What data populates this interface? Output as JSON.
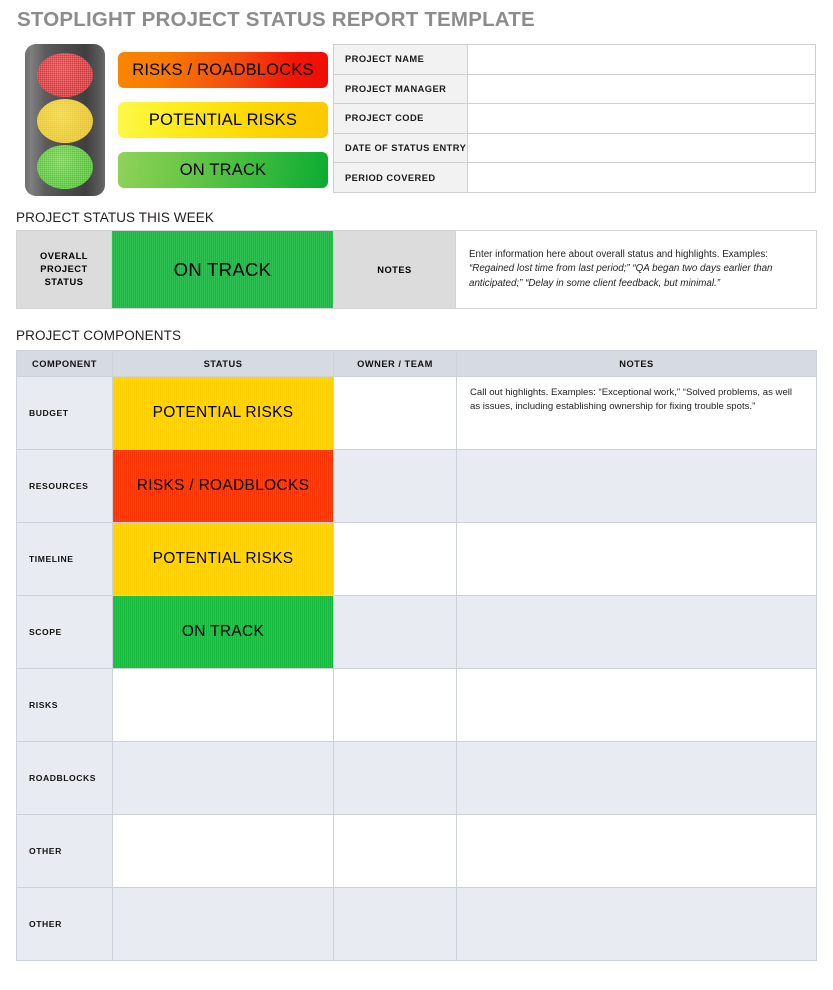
{
  "page_title": "STOPLIGHT PROJECT STATUS REPORT TEMPLATE",
  "colors": {
    "title_gray": "#8c8c8c",
    "green": "#17b93f",
    "yellow": "#ffd000",
    "red": "#f83200",
    "header_blue_gray": "#d6dbe3",
    "row_alt": "#e8ecf2",
    "label_gray": "#dcdcdc"
  },
  "stoplight": {
    "lamps": [
      {
        "name": "red-lamp",
        "color": "#d8383c"
      },
      {
        "name": "yellow-lamp",
        "color": "#ecc92c"
      },
      {
        "name": "green-lamp",
        "color": "#5cc73c"
      }
    ]
  },
  "legend": {
    "bars": [
      {
        "label": "RISKS / ROADBLOCKS",
        "level": "red"
      },
      {
        "label": "POTENTIAL RISKS",
        "level": "yellow"
      },
      {
        "label": "ON TRACK",
        "level": "green"
      }
    ]
  },
  "project_info": {
    "rows": [
      {
        "label": "PROJECT NAME",
        "value": ""
      },
      {
        "label": "PROJECT MANAGER",
        "value": ""
      },
      {
        "label": "PROJECT CODE",
        "value": ""
      },
      {
        "label": "DATE OF STATUS ENTRY",
        "value": ""
      },
      {
        "label": "PERIOD COVERED",
        "value": ""
      }
    ]
  },
  "status_section": {
    "heading": "PROJECT STATUS THIS WEEK",
    "overall_label": "OVERALL PROJECT STATUS",
    "overall_label_lines": [
      "OVERALL",
      "PROJECT",
      "STATUS"
    ],
    "overall_value": "ON TRACK",
    "overall_level": "green",
    "notes_label": "NOTES",
    "notes_plain": "Enter information here about overall status and highlights. Examples: ",
    "notes_italic": "“Regained lost time from last period;” “QA began two days earlier than anticipated;” “Delay in some client feedback, but minimal.”"
  },
  "components_section": {
    "heading": "PROJECT COMPONENTS",
    "columns": [
      "COMPONENT",
      "STATUS",
      "OWNER / TEAM",
      "NOTES"
    ],
    "rows": [
      {
        "component": "BUDGET",
        "status": "POTENTIAL RISKS",
        "level": "yellow",
        "owner": "",
        "notes": "Call out highlights. Examples: “Exceptional work,” “Solved problems, as well as issues, including establishing ownership for fixing trouble spots.”",
        "band": "white"
      },
      {
        "component": "RESOURCES",
        "status": "RISKS / ROADBLOCKS",
        "level": "red",
        "owner": "",
        "notes": "",
        "band": "alt"
      },
      {
        "component": "TIMELINE",
        "status": "POTENTIAL RISKS",
        "level": "yellow",
        "owner": "",
        "notes": "",
        "band": "white"
      },
      {
        "component": "SCOPE",
        "status": "ON TRACK",
        "level": "green",
        "owner": "",
        "notes": "",
        "band": "alt"
      },
      {
        "component": "RISKS",
        "status": "",
        "level": "none",
        "owner": "",
        "notes": "",
        "band": "white"
      },
      {
        "component": "ROADBLOCKS",
        "status": "",
        "level": "none",
        "owner": "",
        "notes": "",
        "band": "alt"
      },
      {
        "component": "OTHER",
        "status": "",
        "level": "none",
        "owner": "",
        "notes": "",
        "band": "white"
      },
      {
        "component": "OTHER",
        "status": "",
        "level": "none",
        "owner": "",
        "notes": "",
        "band": "alt"
      }
    ]
  }
}
